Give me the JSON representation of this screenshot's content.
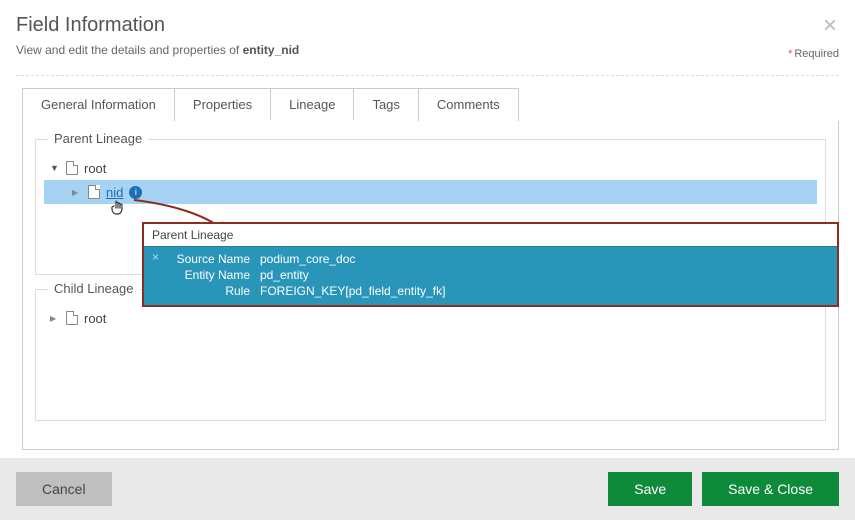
{
  "header": {
    "title": "Field Information",
    "subtitle_prefix": "View and edit the details and properties of ",
    "subtitle_bold": "entity_nid",
    "required_label": "Required"
  },
  "tabs": [
    {
      "id": "general",
      "label": "General Information",
      "active": false
    },
    {
      "id": "properties",
      "label": "Properties",
      "active": false
    },
    {
      "id": "lineage",
      "label": "Lineage",
      "active": true
    },
    {
      "id": "tags",
      "label": "Tags",
      "active": false
    },
    {
      "id": "comments",
      "label": "Comments",
      "active": false
    }
  ],
  "lineage": {
    "parent": {
      "title": "Parent Lineage",
      "root_label": "root",
      "selected_node": "nid"
    },
    "child": {
      "title": "Child Lineage",
      "root_label": "root"
    }
  },
  "popup": {
    "title": "Parent Lineage",
    "rows": [
      {
        "k": "Source Name",
        "v": "podium_core_doc"
      },
      {
        "k": "Entity Name",
        "v": "pd_entity"
      },
      {
        "k": "Rule",
        "v": "FOREIGN_KEY[pd_field_entity_fk]"
      }
    ]
  },
  "footer": {
    "cancel": "Cancel",
    "save": "Save",
    "save_close": "Save & Close"
  }
}
